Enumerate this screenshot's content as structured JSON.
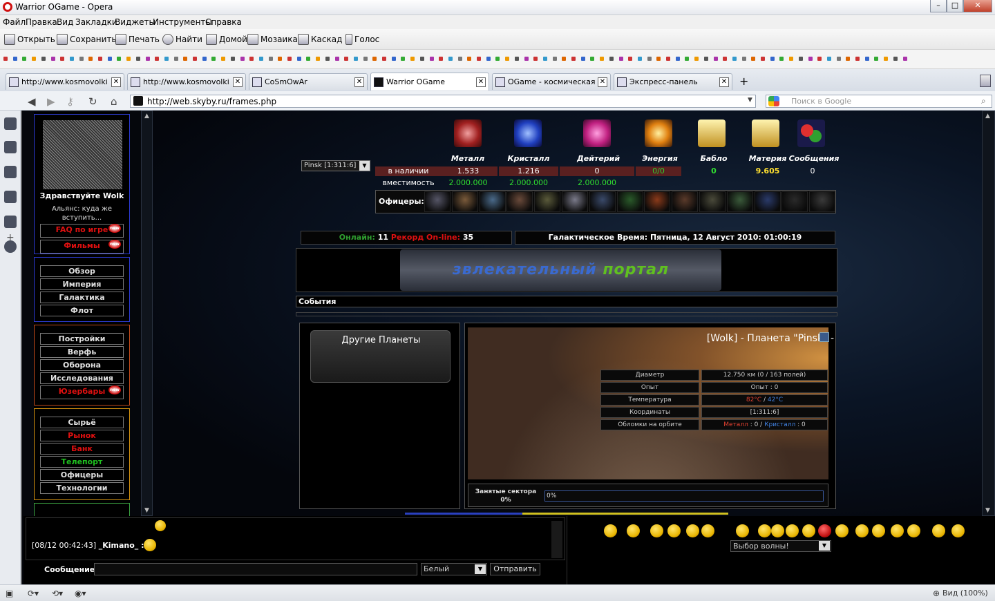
{
  "window": {
    "title": "Warrior OGame - Opera",
    "min": "–",
    "max": "□",
    "close": "✕"
  },
  "menu": [
    "Файл",
    "Правка",
    "Вид",
    "Закладки",
    "Виджеты",
    "Инструменты",
    "Справка"
  ],
  "toolbar": [
    "Открыть",
    "Сохранить",
    "Печать",
    "Найти",
    "Домой",
    "Мозаика",
    "Каскад",
    "Голос"
  ],
  "tabs": [
    {
      "title": "http://www.kosmovolki.…",
      "close": "✕"
    },
    {
      "title": "http://www.kosmovolki.…",
      "close": "✕"
    },
    {
      "title": "CoSmOwAr",
      "close": "✕"
    },
    {
      "title": "Warrior OGame",
      "close": "✕"
    },
    {
      "title": "OGame - космическая с…",
      "close": "✕"
    },
    {
      "title": "Экспресс-панель",
      "close": "✕"
    }
  ],
  "newtab": "+",
  "address": {
    "url": "http://web.skyby.ru/frames.php",
    "search_placeholder": "Поиск в Google",
    "dropdown": "▼"
  },
  "nav": {
    "greeting": "Здравствуйте Wolk",
    "alliance": "Альянс: куда же вступить...",
    "box1": [
      {
        "label": "FAQ по игре",
        "color": "#e01010",
        "badge": "new"
      },
      {
        "label": "Фильмы",
        "color": "#e01010",
        "badge": "new"
      }
    ],
    "box2": [
      {
        "label": "Обзор",
        "color": "#e0e0e0"
      },
      {
        "label": "Империя",
        "color": "#e0e0e0"
      },
      {
        "label": "Галактика",
        "color": "#e0e0e0"
      },
      {
        "label": "Флот",
        "color": "#e0e0e0"
      }
    ],
    "box3": [
      {
        "label": "Постройки",
        "color": "#e0e0e0"
      },
      {
        "label": "Верфь",
        "color": "#e0e0e0"
      },
      {
        "label": "Оборона",
        "color": "#e0e0e0"
      },
      {
        "label": "Исследования",
        "color": "#e0e0e0"
      },
      {
        "label": "Юзербары",
        "color": "#e01010",
        "badge": "new"
      }
    ],
    "box4": [
      {
        "label": "Сырьё",
        "color": "#e0e0e0"
      },
      {
        "label": "Рынок",
        "color": "#e01010"
      },
      {
        "label": "Банк",
        "color": "#e01010"
      },
      {
        "label": "Телепорт",
        "color": "#20c020"
      },
      {
        "label": "Офицеры",
        "color": "#e0e0e0"
      },
      {
        "label": "Технологии",
        "color": "#e0e0e0"
      }
    ]
  },
  "planet_select": "Pinsk [1:311:6]",
  "resources": {
    "names": [
      "Металл",
      "Кристалл",
      "Дейтерий",
      "Энергия",
      "Бабло",
      "Материя",
      "Сообщения"
    ],
    "row_available_label": "в наличии",
    "row_capacity_label": "вместимость",
    "available": [
      "1.533",
      "1.216",
      "0",
      "0/0"
    ],
    "capacity": [
      "2.000.000",
      "2.000.000",
      "2.000.000"
    ],
    "extra": [
      "0",
      "9.605",
      "0"
    ]
  },
  "officers_label": "Офицеры:",
  "online": {
    "label": "Онлайн:",
    "value": "11",
    "record_label": "Рекорд On-line:",
    "record_value": "35"
  },
  "galaxy_time": "Галактическое Время: Пятница, 12 Август 2010: 01:00:19",
  "banner_text": {
    "part1": "звлекательный",
    "part2": "портал"
  },
  "events_label": "События",
  "other_planets": "Другие Планеты",
  "planet": {
    "title": "[Wolk] - Планета \"Pinsk\" -",
    "rows": [
      {
        "label": "Диаметр",
        "value": "12.750 км (0 / 163 полей)"
      },
      {
        "label": "Опыт",
        "value": "Опыт : 0"
      },
      {
        "label": "Температура",
        "value_parts": [
          "82°C",
          " / ",
          "42°C"
        ]
      },
      {
        "label": "Координаты",
        "value": "[1:311:6]"
      },
      {
        "label": "Обломки на орбите",
        "value_parts": [
          "Металл",
          " : 0 / ",
          "Кристалл",
          " : 0"
        ]
      }
    ],
    "sectors_label": "Занятые сектора 0%",
    "sectors_bar": "0%"
  },
  "chat": {
    "line_time": "[08/12 00:42:43]",
    "line_user": "_Kimano_ :",
    "msg_label": "Сообщение:",
    "color": "Белый",
    "send": "Отправить"
  },
  "wave_select": "Выбор волны!",
  "status": {
    "zoom": "Вид (100%)"
  }
}
